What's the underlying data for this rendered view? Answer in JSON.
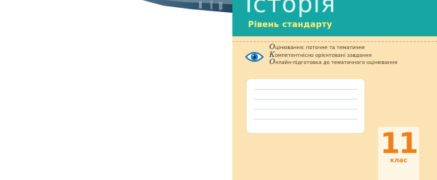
{
  "cover": {
    "title": "Історія",
    "subtitle": "Рівень стандарту",
    "features": [
      {
        "initial": "О",
        "rest": "цінювання: поточне та тематичне"
      },
      {
        "initial": "К",
        "rest": "омпетентнісно орієнтовані завдання"
      },
      {
        "initial": "О",
        "rest": "нлайн-підготовка до тематичного оцінювання"
      }
    ],
    "grade": {
      "number": "11",
      "label": "клас"
    },
    "colors": {
      "header": "#16a7a5",
      "subtitle": "#fff37a",
      "background": "#fbe3b3",
      "grade": "#ef7f1a",
      "eye_iris": "#1d7bb8"
    }
  },
  "icons": {
    "feature_icon": "eye-icon"
  }
}
